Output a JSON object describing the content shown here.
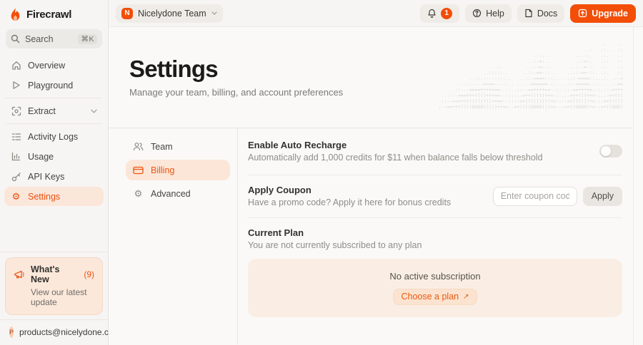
{
  "brand": {
    "name": "Firecrawl"
  },
  "topbar": {
    "team_name": "Nicelydone Team",
    "team_initial": "N",
    "notification_count": "1",
    "help_label": "Help",
    "docs_label": "Docs",
    "upgrade_label": "Upgrade"
  },
  "sidebar": {
    "search": {
      "label": "Search",
      "shortcut": "⌘K"
    },
    "items": [
      {
        "label": "Overview"
      },
      {
        "label": "Playground"
      },
      {
        "label": "Extract"
      },
      {
        "label": "Activity Logs"
      },
      {
        "label": "Usage"
      },
      {
        "label": "API Keys"
      },
      {
        "label": "Settings"
      }
    ],
    "whats_new": {
      "title": "What's New",
      "count": "(9)",
      "subtitle": "View our latest update"
    },
    "account": {
      "initial": "P",
      "email": "products@nicelydone.club"
    }
  },
  "page": {
    "title": "Settings",
    "subtitle": "Manage your team, billing, and account preferences"
  },
  "settings_nav": [
    {
      "label": "Team"
    },
    {
      "label": "Billing"
    },
    {
      "label": "Advanced"
    }
  ],
  "billing": {
    "auto_recharge": {
      "title": "Enable Auto Recharge",
      "description": "Automatically add 1,000 credits for $11 when balance falls below threshold",
      "enabled": false
    },
    "coupon": {
      "title": "Apply Coupon",
      "description": "Have a promo code? Apply it here for bonus credits",
      "placeholder": "Enter coupon code",
      "apply_label": "Apply"
    },
    "current_plan": {
      "title": "Current Plan",
      "description": "You are not currently subscribed to any plan",
      "empty_state": "No active subscription",
      "cta_label": "Choose a plan",
      "cta_arrow": "↗"
    }
  },
  "icons": {
    "settings_gear": "⚙",
    "advanced_gear": "⚙"
  },
  "colors": {
    "accent": "#f24e08",
    "accent_soft_bg": "#fce6d8",
    "sidebar_bg": "#f7f5f3",
    "content_bg": "#faf9f7",
    "card_bg": "#faeee4",
    "divider": "#e9e6e2"
  },
  "decor": {
    "ascii_art": "                                                          .:    .:\n                                                    ..:   ::..  ::\n                                  .:::.          ..:-:.   .:.   .:\n                                ..:-=:..        ..:-=:..  .::   ::\n                    .:.        ..::-=-::.      ..::-=-:.  .:.   .:\n                ..:::::..     ..::-==-::..    ..::-==-::. .:.  .::\n           ..::::-----::..   ..::-====-::..  ..::-====::...:. .:-=\n       ..:::----====---::.. ..:--======-::....::-=====-::..:..:-==\n    ..::---====++++===--::..::--==++++==--::.::-==++++=-::.::-=+++\n  .::--===+++((((+++==--::::--=++(((()++=-::.:-=++(((++=-:.:-=+(((\n.::--==+++((((())))++==--::--=+((((())))+=-::-=+(((())+=-:-=+(((()\n:--==++(((((OOOO)))))++==--=+((((OOOO)))+=--:=+((OOOO)+=-:=+((OOO)"
  }
}
